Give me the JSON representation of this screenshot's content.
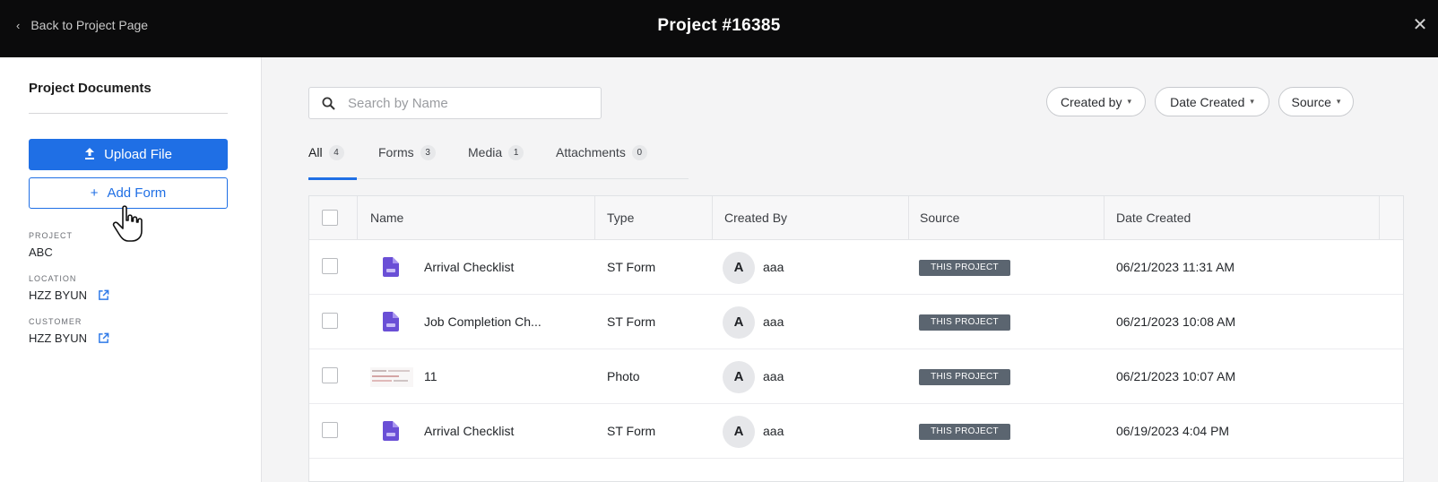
{
  "header": {
    "back_label": "Back to Project Page",
    "title": "Project #16385"
  },
  "sidebar": {
    "title": "Project Documents",
    "upload_label": "Upload File",
    "add_form_label": "Add Form",
    "meta": [
      {
        "label": "PROJECT",
        "value": "ABC",
        "link": false
      },
      {
        "label": "LOCATION",
        "value": "HZZ BYUN",
        "link": true
      },
      {
        "label": "CUSTOMER",
        "value": "HZZ BYUN",
        "link": true
      }
    ]
  },
  "search": {
    "placeholder": "Search by Name"
  },
  "filters": [
    "Created by",
    "Date Created",
    "Source"
  ],
  "tabs": [
    {
      "label": "All",
      "count": "4"
    },
    {
      "label": "Forms",
      "count": "3"
    },
    {
      "label": "Media",
      "count": "1"
    },
    {
      "label": "Attachments",
      "count": "0"
    }
  ],
  "table": {
    "columns": [
      "Name",
      "Type",
      "Created By",
      "Source",
      "Date Created"
    ],
    "rows": [
      {
        "icon": "form-doc-icon",
        "name": "Arrival Checklist",
        "type": "ST Form",
        "avatar": "A",
        "creator": "aaa",
        "source": "THIS PROJECT",
        "date": "06/21/2023 11:31 AM"
      },
      {
        "icon": "form-doc-icon",
        "name": "Job Completion Ch...",
        "type": "ST Form",
        "avatar": "A",
        "creator": "aaa",
        "source": "THIS PROJECT",
        "date": "06/21/2023 10:08 AM"
      },
      {
        "icon": "photo-thumbnail",
        "name": "11",
        "type": "Photo",
        "avatar": "A",
        "creator": "aaa",
        "source": "THIS PROJECT",
        "date": "06/21/2023 10:07 AM"
      },
      {
        "icon": "form-doc-icon",
        "name": "Arrival Checklist",
        "type": "ST Form",
        "avatar": "A",
        "creator": "aaa",
        "source": "THIS PROJECT",
        "date": "06/19/2023 4:04 PM"
      }
    ]
  },
  "colors": {
    "accent": "#1f6fe5",
    "topbar": "#0b0b0c",
    "badge": "#5b6570",
    "form_icon": "#6a4fd6"
  }
}
